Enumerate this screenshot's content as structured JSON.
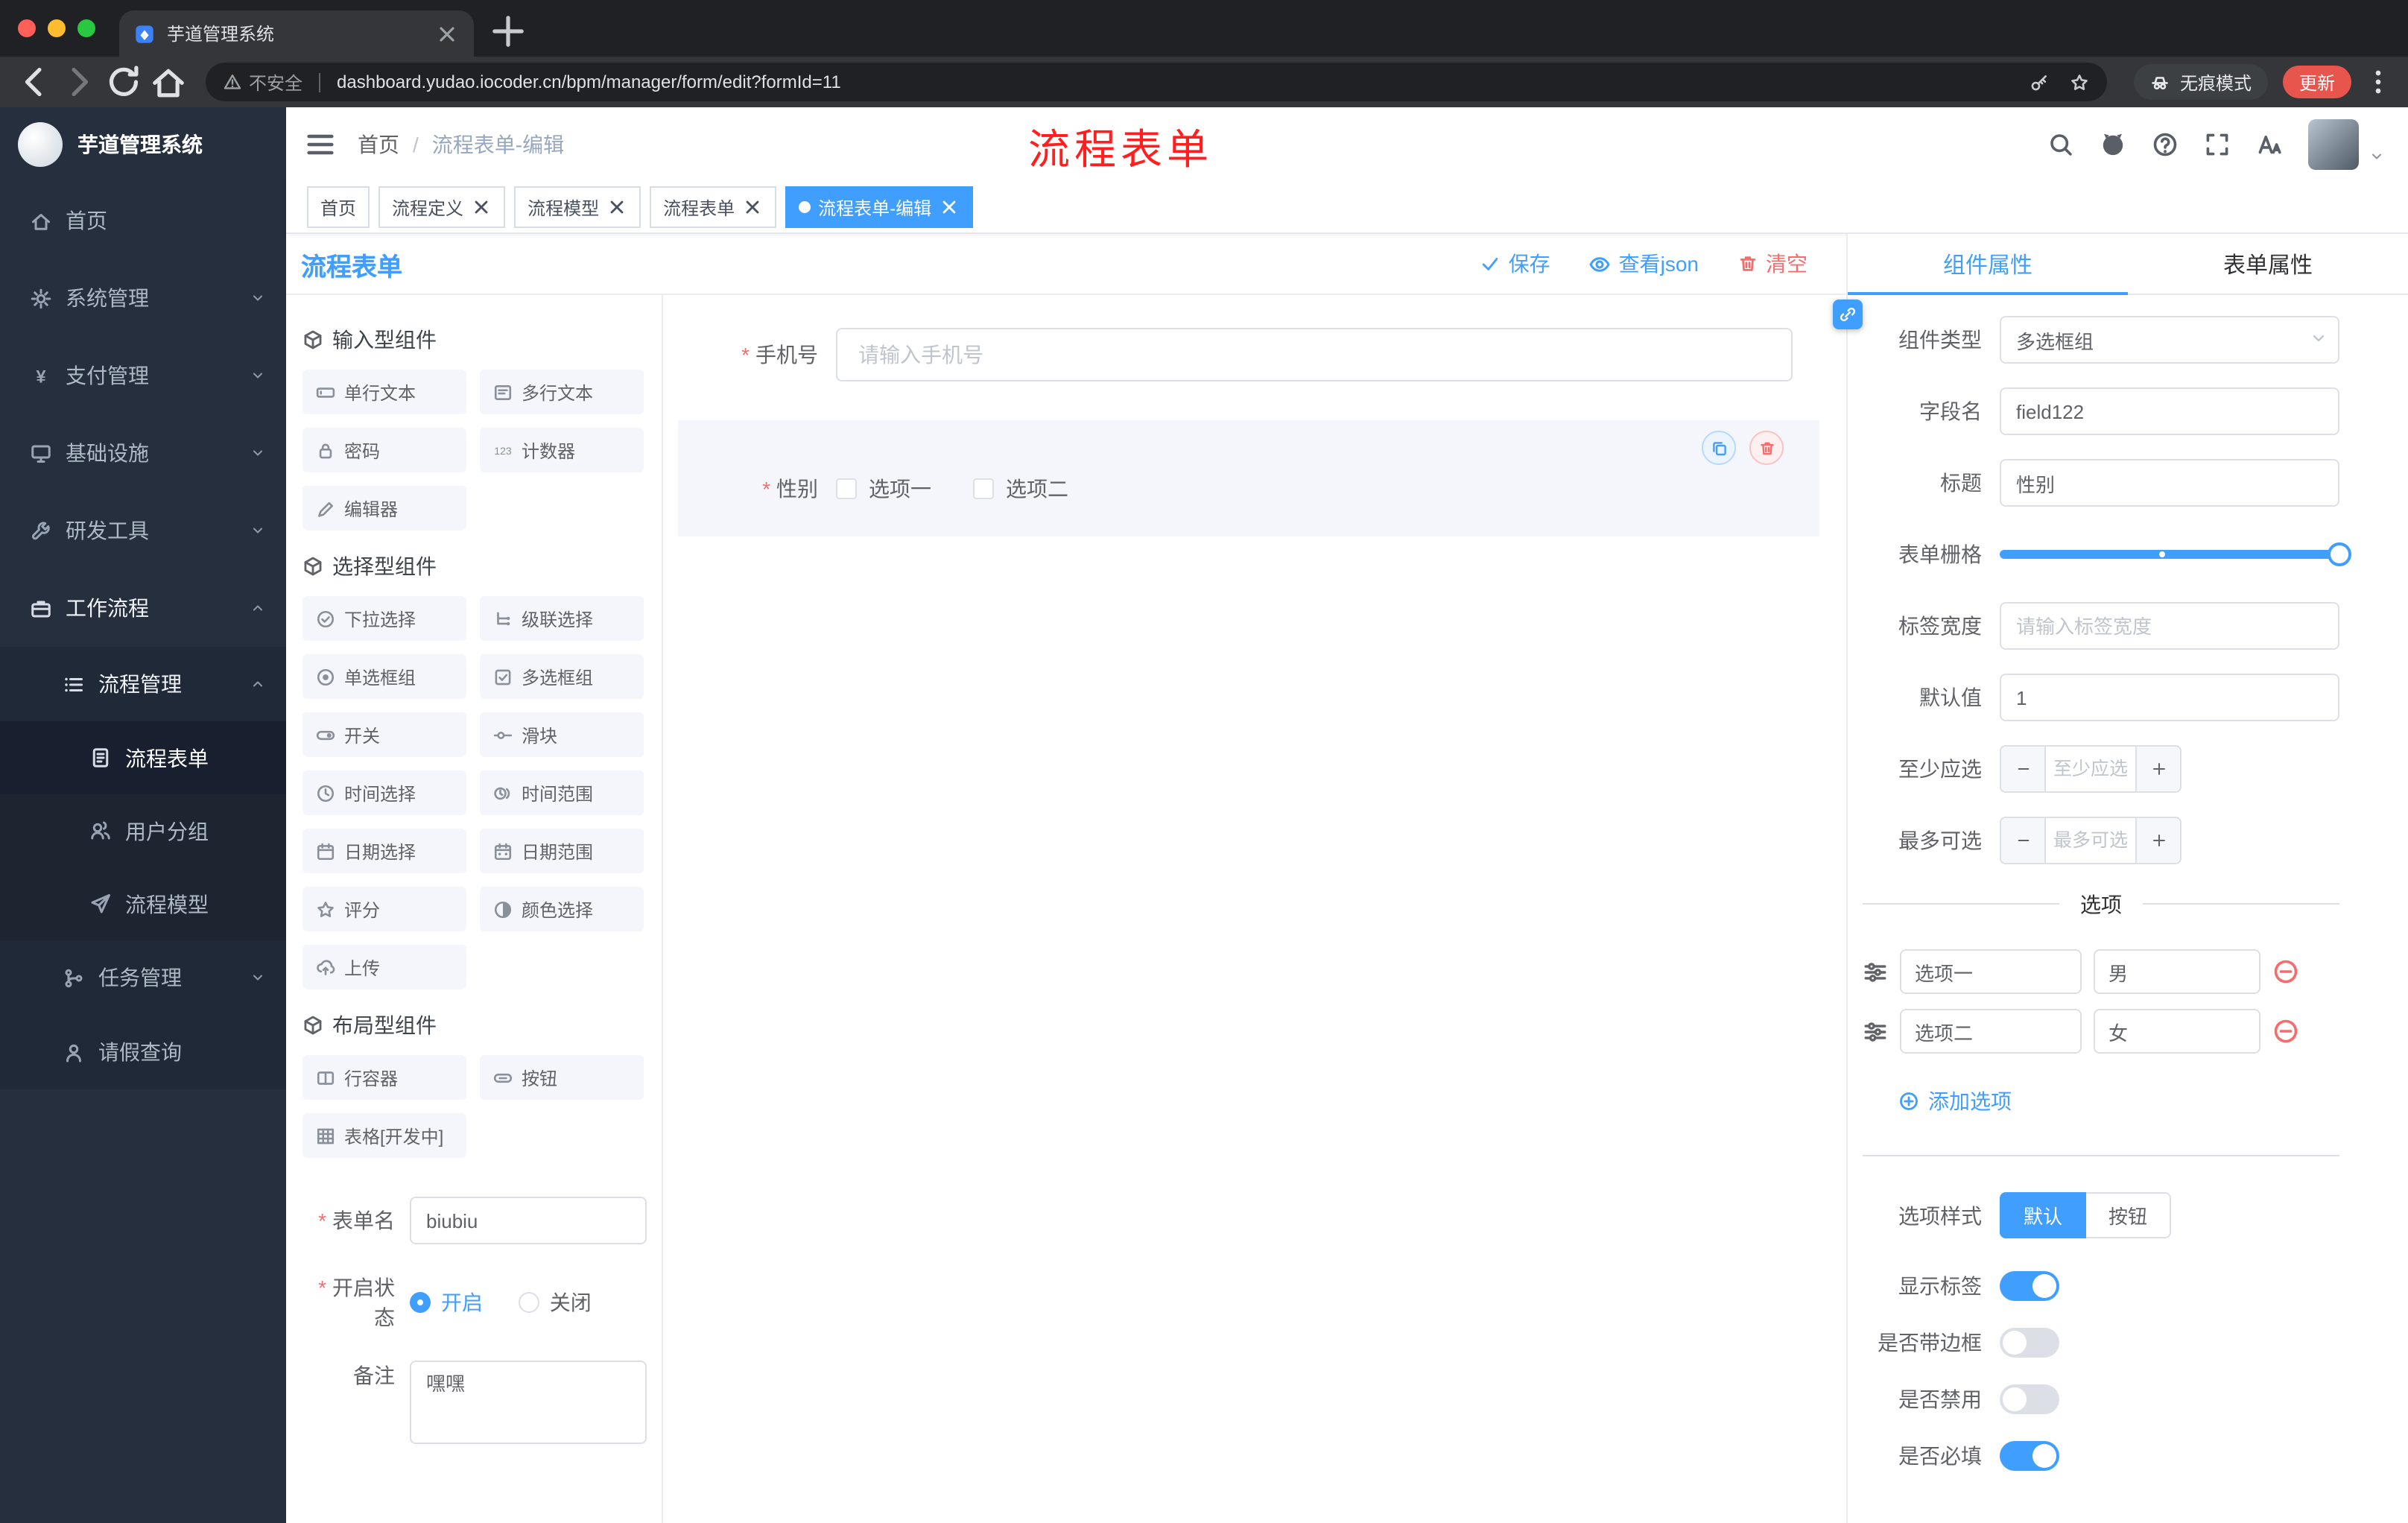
{
  "browser": {
    "tab_title": "芋道管理系统",
    "security": "不安全",
    "url": "dashboard.yudao.iocoder.cn/bpm/manager/form/edit?formId=11",
    "incognito": "无痕模式",
    "update": "更新",
    "nav_icons": [
      "back",
      "forward",
      "reload",
      "home"
    ],
    "url_icons": [
      "warning",
      "key",
      "star"
    ],
    "favicon_icon": "favicon",
    "new_tab_icon": "plus",
    "menu_icon": "kebab"
  },
  "sidebar": {
    "logo_title": "芋道管理系统",
    "items": [
      {
        "label": "首页",
        "icon": "home"
      },
      {
        "label": "系统管理",
        "icon": "gear",
        "chevron": "chev-down"
      },
      {
        "label": "支付管理",
        "icon": "yen",
        "chevron": "chev-down"
      },
      {
        "label": "基础设施",
        "icon": "infra",
        "chevron": "chev-down"
      },
      {
        "label": "研发工具",
        "icon": "tool",
        "chevron": "chev-down"
      },
      {
        "label": "工作流程",
        "icon": "workflow",
        "chevron": "chev-up"
      },
      {
        "label": "流程管理",
        "icon": "list",
        "chevron": "chev-up"
      },
      {
        "label": "流程表单",
        "icon": "form"
      },
      {
        "label": "用户分组",
        "icon": "users"
      },
      {
        "label": "流程模型",
        "icon": "send"
      },
      {
        "label": "任务管理",
        "icon": "branch",
        "chevron": "chev-down"
      },
      {
        "label": "请假查询",
        "icon": "user"
      }
    ]
  },
  "header": {
    "breadcrumb_home": "首页",
    "breadcrumb_current": "流程表单-编辑",
    "annotation": "流程表单",
    "annotation_color": "#ff1f1f",
    "icons": [
      "hamburger",
      "search",
      "github",
      "help",
      "fullscreen",
      "font-size"
    ]
  },
  "tags": {
    "items": [
      {
        "label": "首页"
      },
      {
        "label": "流程定义"
      },
      {
        "label": "流程模型"
      },
      {
        "label": "流程表单"
      },
      {
        "label": "流程表单-编辑"
      }
    ]
  },
  "actionbar": {
    "title": "流程表单",
    "save": "保存",
    "view_json": "查看json",
    "clear": "清空"
  },
  "palette": {
    "sections": [
      {
        "title": "输入型组件",
        "items": [
          {
            "label": "单行文本",
            "icon": "input"
          },
          {
            "label": "多行文本",
            "icon": "textarea"
          },
          {
            "label": "密码",
            "icon": "lock"
          },
          {
            "label": "计数器",
            "icon": "counter"
          },
          {
            "label": "编辑器",
            "icon": "editor"
          }
        ]
      },
      {
        "title": "选择型组件",
        "items": [
          {
            "label": "下拉选择",
            "icon": "select"
          },
          {
            "label": "级联选择",
            "icon": "cascader"
          },
          {
            "label": "单选框组",
            "icon": "radio"
          },
          {
            "label": "多选框组",
            "icon": "checkbox"
          },
          {
            "label": "开关",
            "icon": "switch"
          },
          {
            "label": "滑块",
            "icon": "slider"
          },
          {
            "label": "时间选择",
            "icon": "time"
          },
          {
            "label": "时间范围",
            "icon": "time-range"
          },
          {
            "label": "日期选择",
            "icon": "date"
          },
          {
            "label": "日期范围",
            "icon": "date-range"
          },
          {
            "label": "评分",
            "icon": "star"
          },
          {
            "label": "颜色选择",
            "icon": "color"
          },
          {
            "label": "上传",
            "icon": "upload"
          }
        ]
      },
      {
        "title": "布局型组件",
        "items": [
          {
            "label": "行容器",
            "icon": "row"
          },
          {
            "label": "按钮",
            "icon": "button"
          },
          {
            "label": "表格[开发中]",
            "icon": "table"
          }
        ]
      }
    ],
    "form": {
      "name_label": "表单名",
      "name_value": "biubiu",
      "status_label": "开启状态",
      "status_on": "开启",
      "status_off": "关闭",
      "remark_label": "备注",
      "remark_value": "嘿嘿"
    }
  },
  "canvas": {
    "phone_label": "手机号",
    "phone_placeholder": "请输入手机号",
    "gender_label": "性别",
    "gender_option1": "选项一",
    "gender_option2": "选项二"
  },
  "props": {
    "tab_component": "组件属性",
    "tab_form": "表单属性",
    "type_label": "组件类型",
    "type_value": "多选框组",
    "field_label": "字段名",
    "field_value": "field122",
    "title_label": "标题",
    "title_value": "性别",
    "grid_label": "表单栅格",
    "label_width_label": "标签宽度",
    "label_width_placeholder": "请输入标签宽度",
    "default_label": "默认值",
    "default_value": "1",
    "min_label": "至少应选",
    "min_placeholder": "至少应选",
    "max_label": "最多可选",
    "max_placeholder": "最多可选",
    "options_title": "选项",
    "options": [
      {
        "label": "选项一",
        "value": "男"
      },
      {
        "label": "选项二",
        "value": "女"
      }
    ],
    "add_option": "添加选项",
    "style_label": "选项样式",
    "style_default": "默认",
    "style_button": "按钮",
    "toggle_show_label": "显示标签",
    "toggle_border": "是否带边框",
    "toggle_disabled": "是否禁用",
    "toggle_required": "是否必填"
  },
  "colors": {
    "accent": "#409eff",
    "danger": "#f56c6c"
  }
}
